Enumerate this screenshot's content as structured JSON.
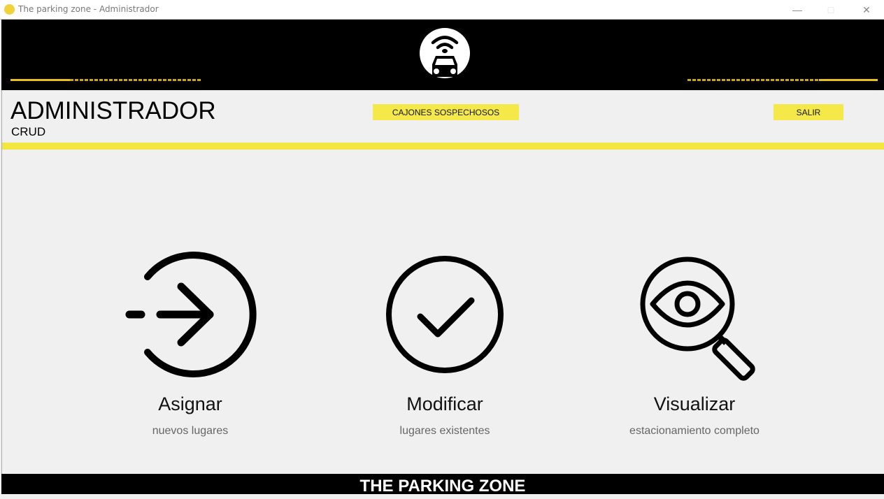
{
  "window": {
    "title": "The parking zone - Administrador",
    "controls": [
      "minimize",
      "maximize",
      "close"
    ]
  },
  "header": {
    "logo_icon": "wifi-car-icon"
  },
  "page": {
    "title": "ADMINISTRADOR",
    "subtitle": "CRUD"
  },
  "toolbar": {
    "suspicious_label": "CAJONES SOSPECHOSOS",
    "exit_label": "SALIR"
  },
  "cards": [
    {
      "icon": "sign-in-arrow-icon",
      "title": "Asignar",
      "subtitle": "nuevos lugares"
    },
    {
      "icon": "check-circle-icon",
      "title": "Modificar",
      "subtitle": "lugares existentes"
    },
    {
      "icon": "eye-magnifier-icon",
      "title": "Visualizar",
      "subtitle": "estacionamiento completo"
    }
  ],
  "footer": {
    "text": "THE PARKING ZONE"
  },
  "colors": {
    "accent": "#f2e640",
    "header": "#000000",
    "stripe": "#e6c21a"
  }
}
